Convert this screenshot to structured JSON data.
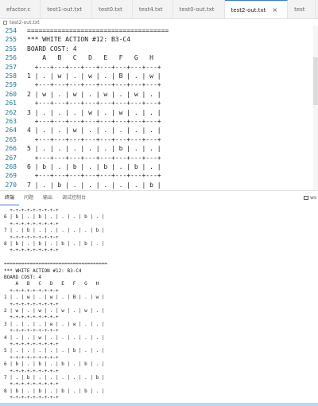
{
  "tabs": [
    {
      "label": "efactor.c",
      "active": false
    },
    {
      "label": "test1-out.txt",
      "active": false
    },
    {
      "label": "test0.txt",
      "active": false
    },
    {
      "label": "test4.txt",
      "active": false
    },
    {
      "label": "test0-out.txt",
      "active": false
    },
    {
      "label": "test2-out.txt",
      "active": true,
      "close": "×"
    },
    {
      "label": "test",
      "active": false
    }
  ],
  "breadcrumb": "test2-out.txt",
  "editor": {
    "lines": [
      {
        "n": "254",
        "t": "====================================="
      },
      {
        "n": "255",
        "t": "*** WHITE ACTION #12: B3-C4"
      },
      {
        "n": "255",
        "t": "BOARD COST: 4"
      },
      {
        "n": "256",
        "t": "    A   B   C   D   E   F   G   H"
      },
      {
        "n": "257",
        "t": "  +---+---+---+---+---+---+---+---+"
      },
      {
        "n": "258",
        "t": "1 | . | w | . | w | . | B | . | w |"
      },
      {
        "n": "259",
        "t": "  +---+---+---+---+---+---+---+---+"
      },
      {
        "n": "260",
        "t": "2 | w | . | w | . | w | . | w | . |"
      },
      {
        "n": "261",
        "t": "  +---+---+---+---+---+---+---+---+"
      },
      {
        "n": "262",
        "t": "3 | . | . | . | w | . | w | . | . |"
      },
      {
        "n": "263",
        "t": "  +---+---+---+---+---+---+---+---+"
      },
      {
        "n": "264",
        "t": "4 | . | . | w | . | . | . | . | . |"
      },
      {
        "n": "265",
        "t": "  +---+---+---+---+---+---+---+---+"
      },
      {
        "n": "266",
        "t": "5 | . | . | . | . | . | b | . | . |"
      },
      {
        "n": "267",
        "t": "  +---+---+---+---+---+---+---+---+"
      },
      {
        "n": "268",
        "t": "6 | b | . | b | . | b | . | b | . |"
      },
      {
        "n": "269",
        "t": "  +---+---+---+---+---+---+---+---+"
      },
      {
        "n": "270",
        "t": "7 | . | b | . | . | . | . | . | b |"
      },
      {
        "n": "271",
        "t": "  +---+---+---+---+---+---+---+---+"
      }
    ]
  },
  "panel": {
    "tabs": [
      "终端",
      "问题",
      "输出",
      "调试控制台"
    ],
    "action_label": "ws",
    "terminal_lines": [
      "  +-+-+-+-+-+-+-+-+",
      "6 | b | . | b | . | . | . | b | . |",
      "  +-+-+-+-+-+-+-+-+",
      "7 | . | b | . | . | . | . | . | b |",
      "  +-+-+-+-+-+-+-+-+",
      "8 | b | . | b | . | b | . | b | . |",
      "  +-+-+-+-+-+-+-+-+",
      "",
      "====================================",
      "*** WHITE ACTION #12: B3-C4",
      "BOARD COST: 4",
      "    A   B   C   D   E   F   G   H",
      "  +-+-+-+-+-+-+-+-+",
      "1 | . | w | . | w | . | B | . | w |",
      "  +-+-+-+-+-+-+-+-+",
      "2 | w | . | w | . | w | . | w | . |",
      "  +-+-+-+-+-+-+-+-+",
      "3 | . | . | . | w | . | w | . | . |",
      "  +-+-+-+-+-+-+-+-+",
      "4 | . | . | w | . | . | . | . | . |",
      "  +-+-+-+-+-+-+-+-+",
      "5 | . | . | . | . | . | b | . | . |",
      "  +-+-+-+-+-+-+-+-+",
      "6 | b | . | b | . | b | . | b | . |",
      "  +-+-+-+-+-+-+-+-+",
      "7 | . | b | . | . | . | . | . | b |",
      "  +-+-+-+-+-+-+-+-+",
      "8 | b | . | b | . | b | . | b | . |",
      "  +-+-+-+-+-+-+-+-+"
    ]
  }
}
